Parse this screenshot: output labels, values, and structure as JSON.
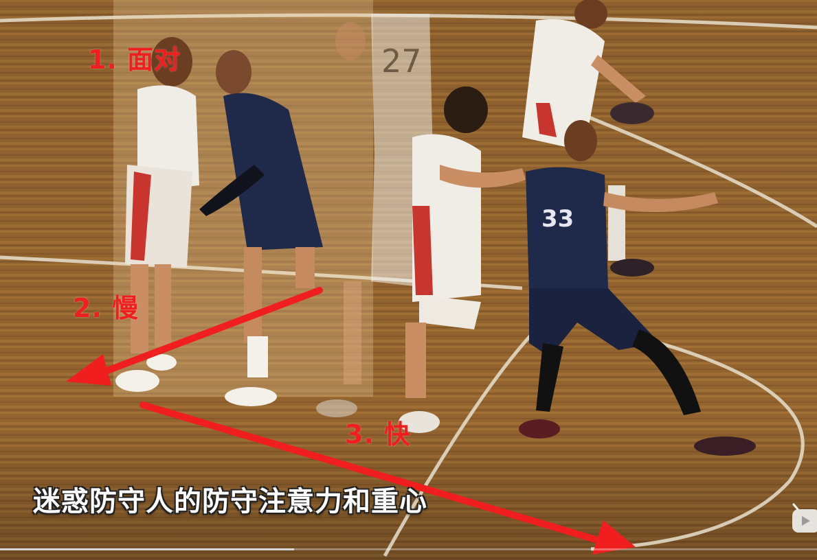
{
  "annotations": {
    "step1": "1. 面对",
    "step2": "2. 慢",
    "step3": "3. 快"
  },
  "caption": "迷惑防守人的防守注意力和重心",
  "players": {
    "jersey_red_back": "27",
    "jersey_navy_front": "33"
  },
  "video": {
    "progress": 0.36
  },
  "colors": {
    "annotation_red": "#f01e1e",
    "court_wood": "#9a6a34",
    "team_navy": "#1f2a4a",
    "team_white": "#f0ece6",
    "team_red_trim": "#c8342e"
  },
  "icons": [
    "video-platform-logo-icon"
  ]
}
